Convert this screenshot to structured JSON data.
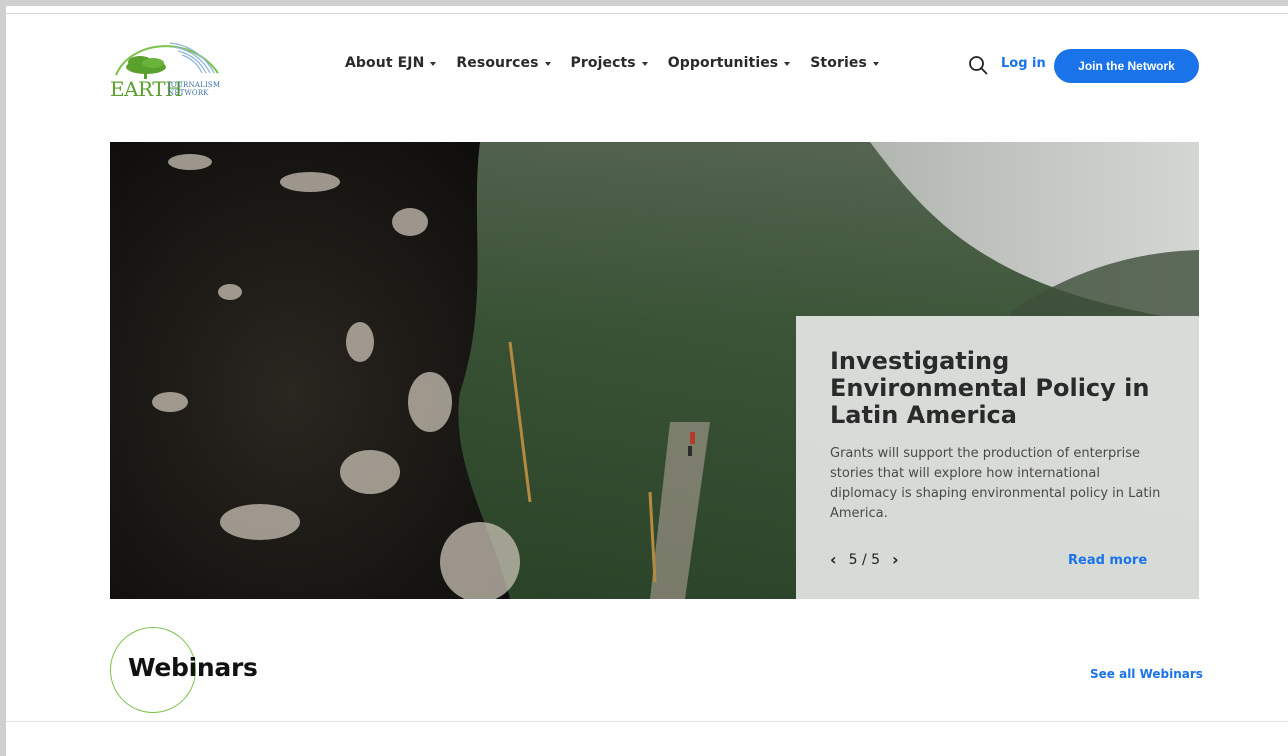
{
  "logo": {
    "earth_text": "EARTH",
    "journalism_line1": "JOURNALISM",
    "journalism_line2": "NETWORK",
    "brand_green": "#5aa02c",
    "brand_blue": "#3a6ea8"
  },
  "nav": {
    "items": [
      {
        "label": "About EJN"
      },
      {
        "label": "Resources"
      },
      {
        "label": "Projects"
      },
      {
        "label": "Opportunities"
      },
      {
        "label": "Stories"
      }
    ],
    "search_icon": "search-icon",
    "login_label": "Log in",
    "join_label": "Join the Network",
    "accent_color": "#1a73e8"
  },
  "hero": {
    "title": "Investigating Environmental Policy in Latin America",
    "description": "Grants will support the production of enterprise stories that will explore how international diplomacy is shaping environmental policy in Latin America.",
    "pager": "5 / 5",
    "prev_icon": "chevron-left-icon",
    "next_icon": "chevron-right-icon",
    "read_more": "Read more"
  },
  "webinars": {
    "title": "Webinars",
    "see_all": "See all Webinars",
    "circle_color": "#7cc24e"
  }
}
